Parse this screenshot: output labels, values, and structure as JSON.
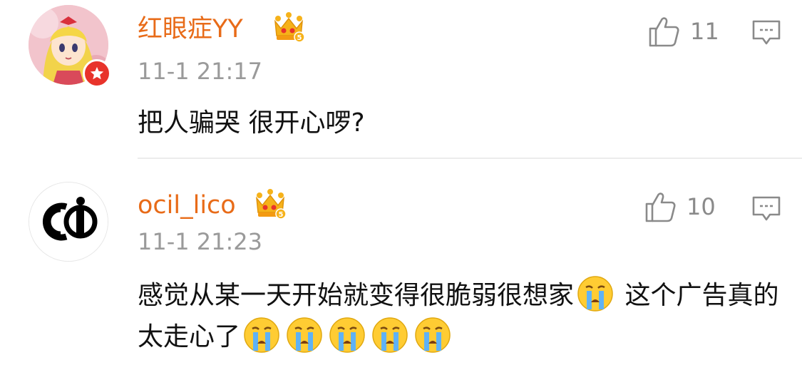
{
  "comments": [
    {
      "username": "红眼症YY",
      "time": "11-1 21:17",
      "text": "把人骗哭 很开心啰?",
      "likes": "11",
      "avatar_icon": "anime-girl-avatar",
      "verified_badge": "red-star-badge"
    },
    {
      "username": "ocil_lico",
      "time": "11-1 21:23",
      "text_part1": "感觉从某一天开始就变得很脆弱很想家",
      "text_part2": " 这个广告真的太走心了",
      "likes": "10",
      "avatar_icon": "ci-logo-avatar"
    }
  ],
  "icons": {
    "member_crown": "vip-crown-level-5",
    "like": "thumbs-up-icon",
    "reply": "comment-bubble-icon",
    "emoji": "crying-face-emoji"
  },
  "colors": {
    "username": "#e86b18",
    "meta": "#9a9a9a",
    "badge_red": "#e8332b",
    "crown_gold": "#f6b21a"
  }
}
